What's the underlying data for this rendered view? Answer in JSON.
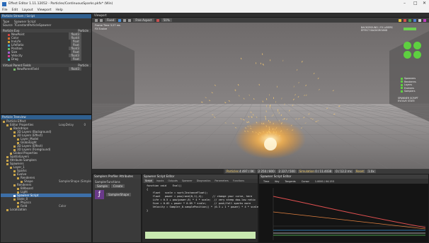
{
  "window": {
    "title": "Effect Editor 1.11.12052 - Particles/ContinuousSparks.pkfx* (Win)",
    "controls": [
      "–",
      "□",
      "✕"
    ]
  },
  "menu": [
    "File",
    "Edit",
    "Layout",
    "Viewport",
    "Help"
  ],
  "left_top": {
    "header": "Particle Stream / Script",
    "type_label": "Type",
    "type_value": "Spawner Script",
    "source_label": "Source",
    "source_value": "TConstantParticleSpawner",
    "section_label": "Particle Evo",
    "section_right": "Particle",
    "fields": [
      {
        "label": "NewPoint",
        "value": "float3"
      },
      {
        "label": "Color",
        "value": "float4"
      },
      {
        "label": "InvLife",
        "value": "float"
      },
      {
        "label": "LifeRatio",
        "value": "float"
      },
      {
        "label": "Position",
        "value": "float3"
      },
      {
        "label": "Size",
        "value": "float"
      },
      {
        "label": "Velocity",
        "value": "float3"
      },
      {
        "label": "Drag",
        "value": "float"
      }
    ],
    "vp_label": "Virtual Parent Fields",
    "vp_right": "Particle",
    "vp_fields": [
      {
        "label": "NewParentField",
        "value": "float3"
      }
    ]
  },
  "tree": {
    "header": "Particle Treeview",
    "items": [
      {
        "label": "Particle Effect",
        "depth": 0
      },
      {
        "label": "Editor Properties",
        "depth": 1,
        "right": "LoopDelay",
        "val": "0"
      },
      {
        "label": "Backdrops",
        "depth": 2
      },
      {
        "label": "3D Layers (Background)",
        "depth": 3
      },
      {
        "label": "3D Layers (Effect)",
        "depth": 3
      },
      {
        "label": "Layer_Model",
        "depth": 4
      },
      {
        "label": "GlobalLight",
        "depth": 4
      },
      {
        "label": "3D Layers (Effect)",
        "depth": 3
      },
      {
        "label": "3D Layers (Foreground)",
        "depth": 3
      },
      {
        "label": "Global Properties",
        "depth": 2
      },
      {
        "label": "SpatialLayers",
        "depth": 1
      },
      {
        "label": "Attribute Samplers",
        "depth": 1
      },
      {
        "label": "Spawners",
        "depth": 1
      },
      {
        "label": "Layer_1",
        "depth": 2
      },
      {
        "label": "Sparks",
        "depth": 3
      },
      {
        "label": "Evolve",
        "depth": 3
      },
      {
        "label": "Renderers",
        "depth": 4
      },
      {
        "label": "Shape",
        "depth": 5,
        "right": "SamplerShape (Simple)"
      },
      {
        "label": "Renderers",
        "depth": 3
      },
      {
        "label": "Billboard",
        "depth": 4
      },
      {
        "label": "Light",
        "depth": 4
      },
      {
        "label": "Spawner Script",
        "depth": 3,
        "selected": true
      },
      {
        "label": "State_0",
        "depth": 3
      },
      {
        "label": "Physics",
        "depth": 4
      },
      {
        "label": "Field",
        "depth": 4,
        "right": "Color"
      },
      {
        "label": "Localization",
        "depth": 1
      }
    ]
  },
  "viewport": {
    "header": "Viewport",
    "mode": "Fixed",
    "aspect": "Free Aspect",
    "toolbar_text": "50%",
    "overlay_tl": [
      "Frame Time 3.27 ms",
      "FX Evolve"
    ],
    "overlay_tr": "BACKGROUND / FX LAYERS",
    "overlay_tr2": "EFFECT BACKGROUND",
    "status_groups": [
      {
        "label": "Particles",
        "value": "4 497 / 0K"
      },
      {
        "label": "",
        "value": "2 250 / 800"
      },
      {
        "label": "",
        "value": "2 227 / 500"
      },
      {
        "label": "Simulation",
        "value": "0 / 11.4038"
      },
      {
        "label": "",
        "value": "0 / 12.2 ms"
      },
      {
        "label": "Reset",
        "value": ""
      },
      {
        "label": "",
        "value": "1.0x"
      }
    ],
    "right_labels": [
      "Spawners",
      "Renderers",
      "Layers",
      "Evolvers",
      "Samplers"
    ],
    "right_small": [
      "SPAWNER SCRIPT",
      "EVOLVE STATE"
    ]
  },
  "bl": {
    "header": "Samplers Profiler Attributes",
    "label": "SamplerFunctions",
    "fields": [
      "Sample",
      "Create"
    ],
    "item": "SamplerShape"
  },
  "code": {
    "header": "Spawner Script Editor",
    "tabs": [
      "Script",
      "Inputs",
      "Outputs",
      "Spawner",
      "Diagnostics",
      "Parameters",
      "Functions"
    ],
    "lines": [
      "function void    Eval()",
      "{",
      "    float   scale = sqrt(InstanceFloat);",
      "    float   power = pow(rand(0,1),4);      // change your curve, here",
      "    Life = 0.5 + pow(power,6) * 4 * scale;  // very steep dow-low ratio",
      "    Size = 0.02 + power * 0.05 * scale;     // push/fall sparks more",
      "",
      "    Velocity = Sampler_0.samplePosition() * (0.3 + 1 * power) * 4 * scale;",
      "}"
    ]
  },
  "curve": {
    "header": "Spawner Script Editor",
    "labels": [
      "Time",
      "Key",
      "Tangents",
      "Cursor",
      "1.0000 / 04.153"
    ]
  }
}
